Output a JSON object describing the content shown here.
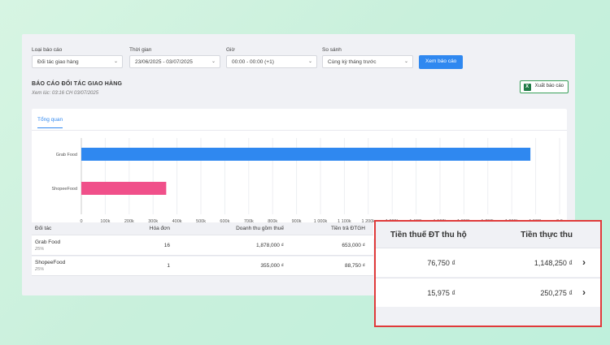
{
  "filters": [
    {
      "label": "Loại báo cáo",
      "value": "Đối tác giao hàng"
    },
    {
      "label": "Thời gian",
      "value": "23/06/2025 - 03/07/2025"
    },
    {
      "label": "Giờ",
      "value": "00:00 - 00:00 (+1)"
    },
    {
      "label": "So sánh",
      "value": "Cùng kỳ tháng trước"
    }
  ],
  "view_report_label": "Xem báo cáo",
  "report": {
    "title": "BÁO CÁO ĐỐI TÁC GIAO HÀNG",
    "subtitle": "Xem lúc: 03:16 CH 03/07/2025",
    "export_label": "Xuất báo cáo",
    "export_icon_letter": "X"
  },
  "tabs": [
    {
      "label": "Tổng quan"
    }
  ],
  "chart_data": {
    "type": "bar",
    "orientation": "horizontal",
    "categories": [
      "Grab Food",
      "ShopeeFood"
    ],
    "values": [
      1878000,
      355000
    ],
    "colors": [
      "#2f88f0",
      "#f0508a"
    ],
    "xlim": [
      0,
      2000000
    ],
    "x_ticks": [
      "0",
      "100k",
      "200k",
      "300k",
      "400k",
      "500k",
      "600k",
      "700k",
      "800k",
      "900k",
      "1 000k",
      "1 100k",
      "1 200k",
      "1 300k",
      "1 400k",
      "1 500k",
      "1 600k",
      "1 700k",
      "1 800k",
      "1 900k",
      "2 0"
    ],
    "grid": true
  },
  "table": {
    "headers": [
      "Đối tác",
      "Hóa đơn",
      "Doanh thu gồm thuế",
      "Tiền trả ĐTGH"
    ],
    "rows": [
      {
        "partner": "Grab Food",
        "share": "25%",
        "invoices": "16",
        "revenue": "1,878,000 ₫",
        "paid": "653,000 ₫"
      },
      {
        "partner": "ShopeeFood",
        "share": "25%",
        "invoices": "1",
        "revenue": "355,000 ₫",
        "paid": "88,750 ₫"
      }
    ]
  },
  "highlight": {
    "border_color": "#e03a3a",
    "headers": [
      "Tiền thuế ĐT thu hộ",
      "Tiền thực thu"
    ],
    "rows": [
      {
        "tax": "76,750 ₫",
        "actual": "1,148,250 ₫",
        "arrow": "›"
      },
      {
        "tax": "15,975 ₫",
        "actual": "250,275 ₫",
        "arrow": "›"
      }
    ]
  }
}
